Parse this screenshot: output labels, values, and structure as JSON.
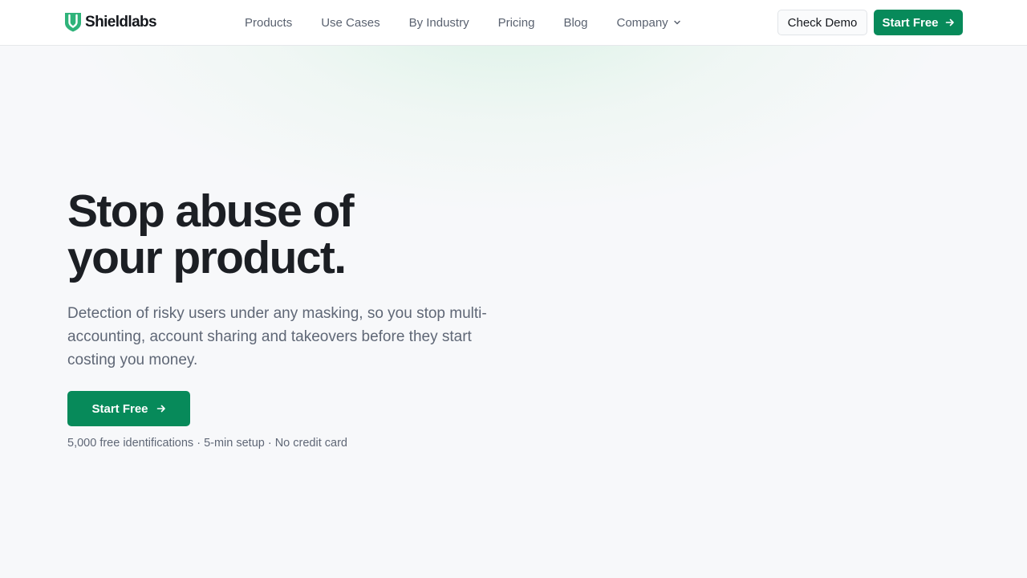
{
  "brand": {
    "name": "Shieldlabs",
    "accent_color": "#078a5a",
    "logo_icon": "shield-logo-icon"
  },
  "nav": {
    "items": [
      {
        "label": "Products"
      },
      {
        "label": "Use Cases"
      },
      {
        "label": "By Industry"
      },
      {
        "label": "Pricing"
      },
      {
        "label": "Blog"
      },
      {
        "label": "Company",
        "icon": "chevron-down-icon"
      }
    ]
  },
  "header_actions": {
    "demo_label": "Check Demo",
    "start_label": "Start Free",
    "start_icon": "arrow-right-icon"
  },
  "hero": {
    "title_line1": "Stop abuse of",
    "title_line2": "your product.",
    "subtitle": "Detection of risky users under any masking, so you stop multi-accounting, account sharing and takeovers before they start costing you money.",
    "cta_label": "Start Free",
    "cta_icon": "arrow-right-icon",
    "note": "5,000 free identifications · 5-min setup · No credit card"
  }
}
